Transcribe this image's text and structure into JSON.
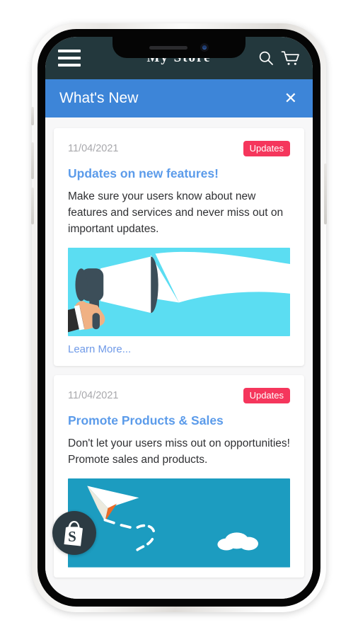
{
  "device": {
    "type": "smartphone-mockup",
    "notch": {
      "speaker": "earpiece-speaker",
      "camera": "front-camera"
    },
    "buttons": [
      "mute-switch",
      "volume-up",
      "volume-down",
      "power"
    ]
  },
  "app_header": {
    "menu_icon": "hamburger-menu-icon",
    "title": "My Store",
    "search_icon": "search-icon",
    "cart_icon": "shopping-cart-icon",
    "background": "#23383d"
  },
  "panel": {
    "title": "What's New",
    "close_label": "✕",
    "close_icon": "close-icon",
    "background": "#3d85d8"
  },
  "cards": [
    {
      "date": "11/04/2021",
      "badge": "Updates",
      "badge_color": "#f5365c",
      "title": "Updates on new features!",
      "title_color": "#5b9bea",
      "body": "Make sure your users know about new features and services and never miss out on important updates.",
      "image_name": "megaphone-announcement-illustration",
      "image_background": "#5bddf2",
      "link_label": "Learn More...",
      "link_color": "#6f9ae8"
    },
    {
      "date": "11/04/2021",
      "badge": "Updates",
      "badge_color": "#f5365c",
      "title": "Promote Products & Sales",
      "title_color": "#5b9bea",
      "body": "Don't let your users miss out on opportunities! Promote sales and products.",
      "image_name": "paper-plane-promotion-illustration",
      "image_background": "#1c9cc0",
      "link_label": "",
      "link_color": "#6f9ae8"
    }
  ],
  "floating_badge": {
    "icon": "shopify-bag-logo-icon",
    "background": "#2c3b43"
  }
}
